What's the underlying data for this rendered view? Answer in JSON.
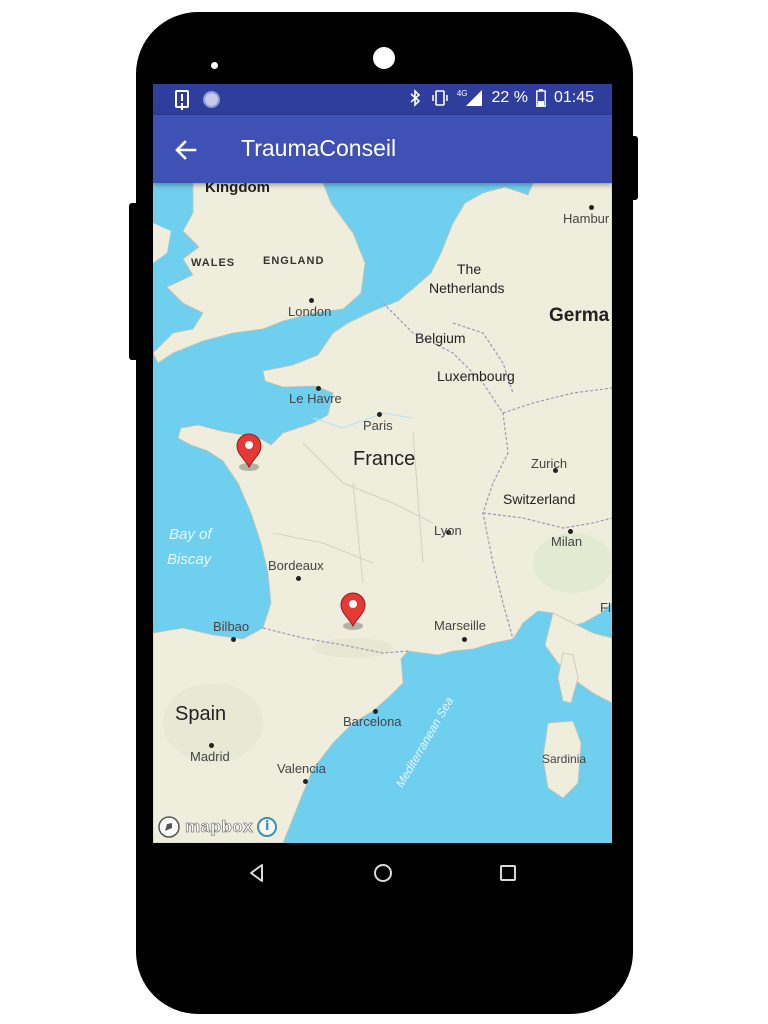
{
  "status_bar": {
    "network": "4G",
    "battery_percent": "22 %",
    "time": "01:45"
  },
  "toolbar": {
    "title": "TraumaConseil"
  },
  "map": {
    "labels": {
      "kingdom": "Kingdom",
      "wales": "WALES",
      "england": "ENGLAND",
      "london": "London",
      "hamburg": "Hambur",
      "the_netherlands_1": "The",
      "the_netherlands_2": "Netherlands",
      "germany": "Germa",
      "belgium": "Belgium",
      "luxembourg": "Luxembourg",
      "le_havre": "Le Havre",
      "paris": "Paris",
      "france": "France",
      "zurich": "Zurich",
      "switzerland": "Switzerland",
      "bay_of_biscay_1": "Bay of",
      "bay_of_biscay_2": "Biscay",
      "lyon": "Lyon",
      "milan": "Milan",
      "bordeaux": "Bordeaux",
      "fl": "Fl",
      "bilbao": "Bilbao",
      "marseille": "Marseille",
      "spain": "Spain",
      "barcelona": "Barcelona",
      "madrid": "Madrid",
      "valencia": "Valencia",
      "sardinia": "Sardinia",
      "mediterranean_sea": "Mediterranean Sea"
    },
    "markers": [
      {
        "name": "marker-brittany",
        "color": "#e53935"
      },
      {
        "name": "marker-toulouse",
        "color": "#e53935"
      }
    ],
    "attribution": "mapbox",
    "info_icon": "i"
  },
  "colors": {
    "status_bar": "#2f3d9c",
    "toolbar": "#3f51b5",
    "water": "#6fcfef",
    "land": "#efeedd",
    "marker": "#e53935"
  }
}
